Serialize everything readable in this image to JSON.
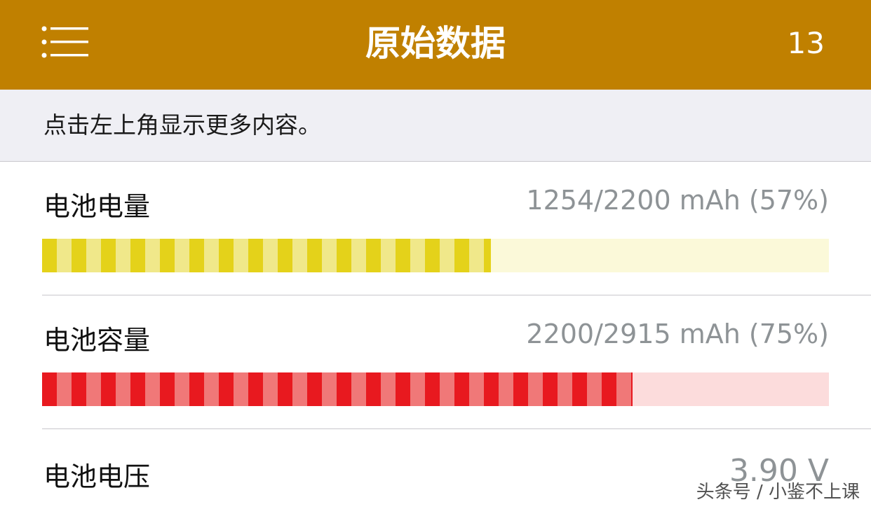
{
  "header": {
    "title": "原始数据",
    "count": "13",
    "menu_icon": "list-menu-icon",
    "background_color": "#c08000"
  },
  "hint": {
    "text": "点击左上角显示更多内容。"
  },
  "rows": [
    {
      "label": "电池电量",
      "value": "1254/2200 mAh (57%)",
      "percent": 57,
      "bar_color_dark": "#e4d21a",
      "bar_color_light": "#f0e88a",
      "bar_track_color": "#fbf9d9"
    },
    {
      "label": "电池容量",
      "value": "2200/2915 mAh (75%)",
      "percent": 75,
      "bar_color_dark": "#e8191f",
      "bar_color_light": "#f07878",
      "bar_track_color": "#fcdcdc"
    },
    {
      "label": "电池电压",
      "value": "3.90 V"
    }
  ],
  "watermark": "头条号 / 小鉴不上课"
}
